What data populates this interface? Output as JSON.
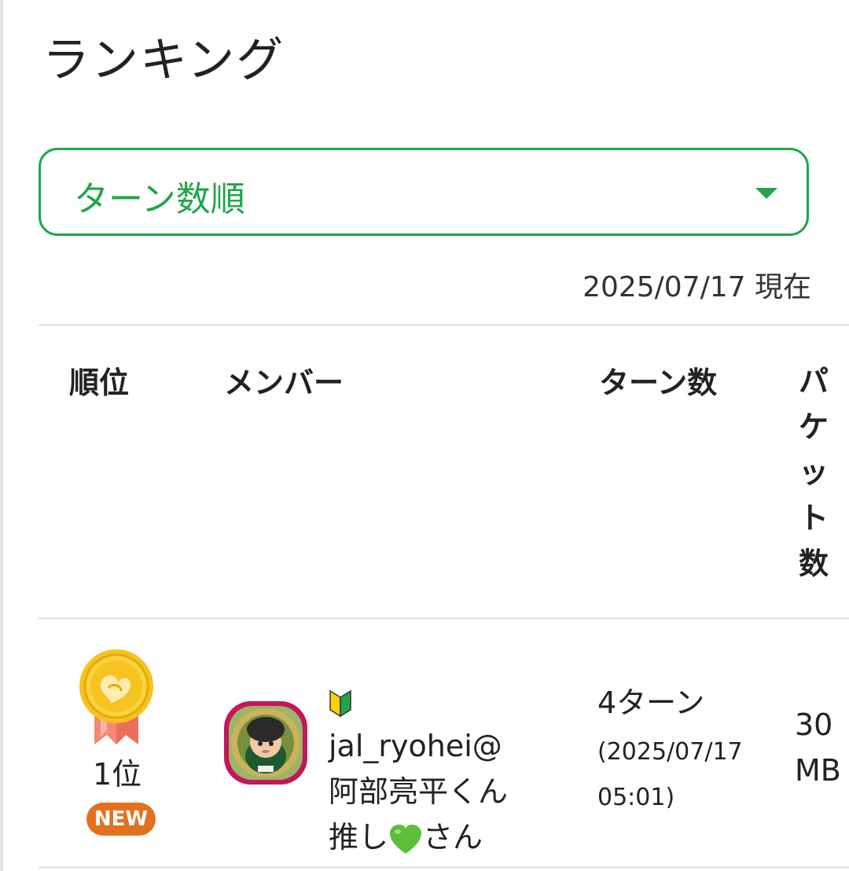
{
  "header": {
    "title": "ランキング"
  },
  "sort": {
    "selected": "ターン数順",
    "icon": "caret-down-icon",
    "accent": "#1fa64a"
  },
  "as_of": "2025/07/17 現在",
  "table": {
    "columns": {
      "rank": "順位",
      "member": "メンバー",
      "turns": "ターン数",
      "packets_chars": [
        "パ",
        "ケ",
        "ッ",
        "ト",
        "数"
      ]
    },
    "rows": [
      {
        "rank": "1位",
        "badge": "NEW",
        "badge_color": "#e2701f",
        "medal": "gold-medal-icon",
        "avatar": "avatar-image",
        "member_handle": "jal_ryohei@",
        "member_line2": "阿部亮平くん",
        "member_line3_a": "推し",
        "member_line3_b": "さん",
        "turns": "4ターン",
        "turn_date": "(2025/07/17 05:01)",
        "packets_value": "30",
        "packets_unit": "MB"
      }
    ]
  }
}
